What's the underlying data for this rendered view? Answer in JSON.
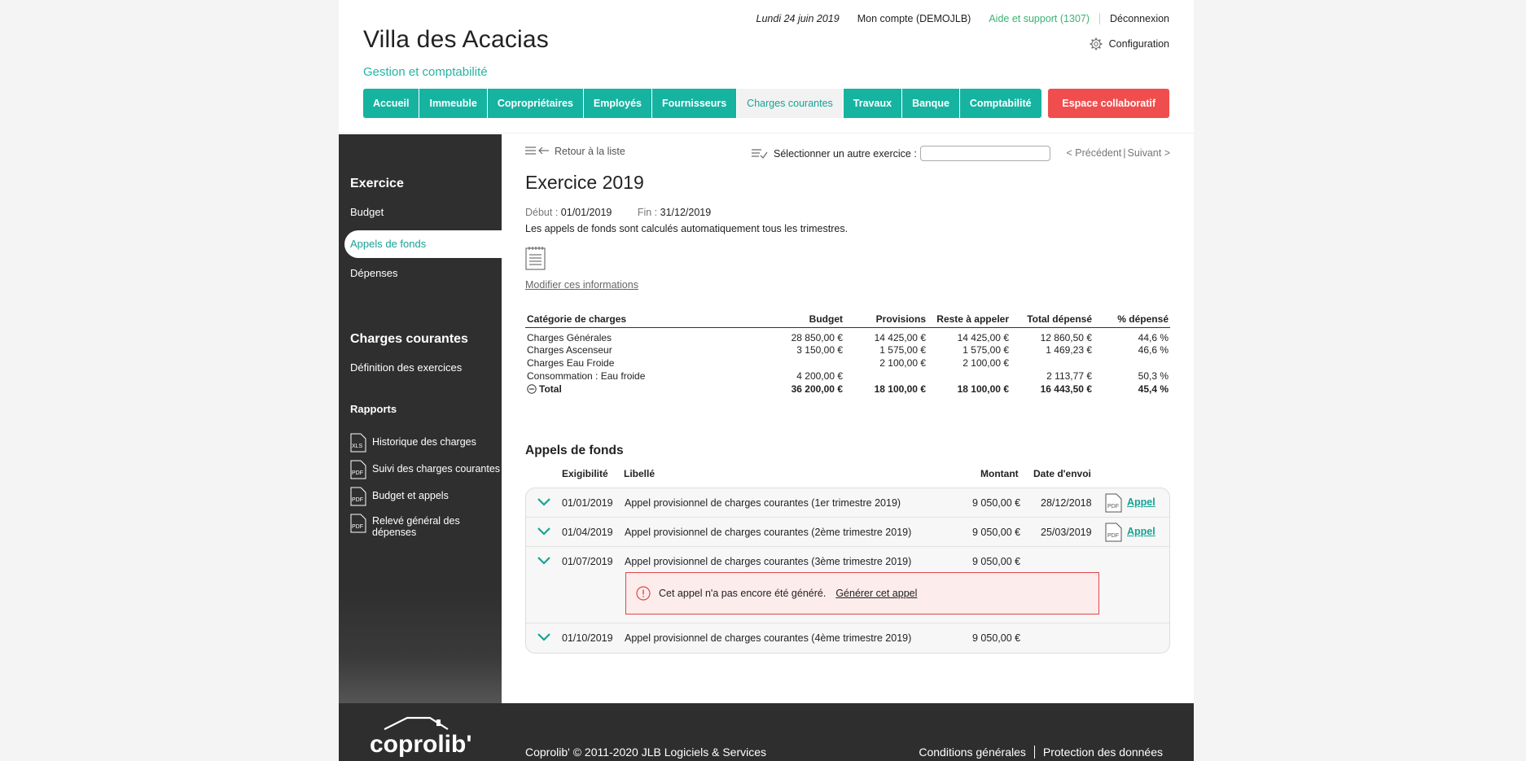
{
  "header": {
    "title": "Villa des Acacias",
    "subtitle": "Gestion et comptabilité",
    "date": "Lundi 24 juin 2019",
    "account": "Mon compte (DEMOJLB)",
    "support": "Aide et support (1307)",
    "logout": "Déconnexion",
    "config": "Configuration",
    "collab": "Espace collaboratif"
  },
  "nav": [
    "Accueil",
    "Immeuble",
    "Copropriétaires",
    "Employés",
    "Fournisseurs",
    "Charges courantes",
    "Travaux",
    "Banque",
    "Comptabilité"
  ],
  "sidebar": {
    "exercice_heading": "Exercice",
    "budget": "Budget",
    "appels": "Appels de fonds",
    "depenses": "Dépenses",
    "charges_heading": "Charges courantes",
    "definition": "Définition des exercices",
    "rapports_heading": "Rapports",
    "reports": [
      {
        "label": "Historique des charges",
        "type": "XLS"
      },
      {
        "label": "Suivi des charges courantes",
        "type": "PDF"
      },
      {
        "label": "Budget et appels",
        "type": "PDF"
      },
      {
        "label": "Relevé général des dépenses",
        "type": "PDF"
      }
    ]
  },
  "toolbar": {
    "back": "Retour à la liste",
    "select_label": "Sélectionner un autre exercice :",
    "prev": "< Précédent",
    "next": "Suivant >"
  },
  "exercise": {
    "title": "Exercice 2019",
    "start_label": "Début :",
    "start": "01/01/2019",
    "end_label": "Fin :",
    "end": "31/12/2019",
    "info": "Les appels de fonds sont calculés automatiquement tous les trimestres.",
    "modify": "Modifier ces informations"
  },
  "charges_table": {
    "headers": [
      "Catégorie de charges",
      "Budget",
      "Provisions",
      "Reste à appeler",
      "Total dépensé",
      "% dépensé"
    ],
    "rows": [
      [
        "Charges Générales",
        "28 850,00 €",
        "14 425,00 €",
        "14 425,00 €",
        "12 860,50 €",
        "44,6 %"
      ],
      [
        "Charges Ascenseur",
        "3 150,00 €",
        "1 575,00 €",
        "1 575,00 €",
        "1 469,23 €",
        "46,6 %"
      ],
      [
        "Charges Eau Froide",
        "",
        "2 100,00 €",
        "2 100,00 €",
        "",
        ""
      ],
      [
        "Consommation : Eau froide",
        "4 200,00 €",
        "",
        "",
        "2 113,77 €",
        "50,3 %"
      ]
    ],
    "total": [
      "Total",
      "36 200,00 €",
      "18 100,00 €",
      "18 100,00 €",
      "16 443,50 €",
      "45,4 %"
    ]
  },
  "appels": {
    "title": "Appels de fonds",
    "headers": {
      "exigibilite": "Exigibilité",
      "libelle": "Libellé",
      "montant": "Montant",
      "date_envoi": "Date d'envoi"
    },
    "rows": [
      {
        "date": "01/01/2019",
        "libelle": "Appel provisionnel de charges courantes (1er trimestre 2019)",
        "montant": "9 050,00 €",
        "envoi": "28/12/2018",
        "link": "Appel"
      },
      {
        "date": "01/04/2019",
        "libelle": "Appel provisionnel de charges courantes (2ème trimestre 2019)",
        "montant": "9 050,00 €",
        "envoi": "25/03/2019",
        "link": "Appel"
      },
      {
        "date": "01/07/2019",
        "libelle": "Appel provisionnel de charges courantes (3ème trimestre 2019)",
        "montant": "9 050,00 €",
        "envoi": "",
        "link": ""
      },
      {
        "date": "01/10/2019",
        "libelle": "Appel provisionnel de charges courantes (4ème trimestre 2019)",
        "montant": "9 050,00 €",
        "envoi": "",
        "link": ""
      }
    ],
    "alert_text": "Cet appel n'a pas encore été généré.",
    "alert_link": "Générer cet appel"
  },
  "footer": {
    "logo": "coprolib'",
    "copyright": "Coprolib' © 2011-2020 JLB Logiciels & Services",
    "terms": "Conditions générales",
    "privacy": "Protection des données"
  },
  "colors": {
    "accent": "#16b3a1",
    "collab": "#f04e4e",
    "sidebar": "#2f2f2f",
    "support": "#3cb371"
  }
}
